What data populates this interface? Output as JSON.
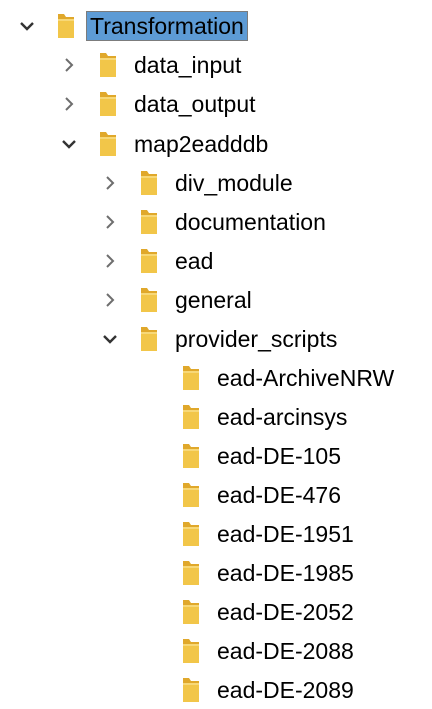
{
  "tree": {
    "root": {
      "label": "Transformation",
      "expanded": true,
      "selected": true,
      "icon": "folder-icon"
    },
    "children": [
      {
        "label": "data_input",
        "expanded": false,
        "icon": "folder-icon"
      },
      {
        "label": "data_output",
        "expanded": false,
        "icon": "folder-icon"
      },
      {
        "label": "map2eadddb",
        "expanded": true,
        "icon": "folder-icon",
        "children": [
          {
            "label": "div_module",
            "expanded": false
          },
          {
            "label": "documentation",
            "expanded": false
          },
          {
            "label": "ead",
            "expanded": false
          },
          {
            "label": "general",
            "expanded": false
          },
          {
            "label": "provider_scripts",
            "expanded": true,
            "children": [
              {
                "label": "ead-ArchiveNRW"
              },
              {
                "label": "ead-arcinsys"
              },
              {
                "label": "ead-DE-105"
              },
              {
                "label": "ead-DE-476"
              },
              {
                "label": "ead-DE-1951"
              },
              {
                "label": "ead-DE-1985"
              },
              {
                "label": "ead-DE-2052"
              },
              {
                "label": "ead-DE-2088"
              },
              {
                "label": "ead-DE-2089"
              }
            ]
          }
        ]
      }
    ]
  },
  "colors": {
    "selection_background": "#5d9bd5",
    "folder_fill": "#f2c649",
    "folder_back": "#e0a82b",
    "chevron": "#6e6e6e"
  }
}
